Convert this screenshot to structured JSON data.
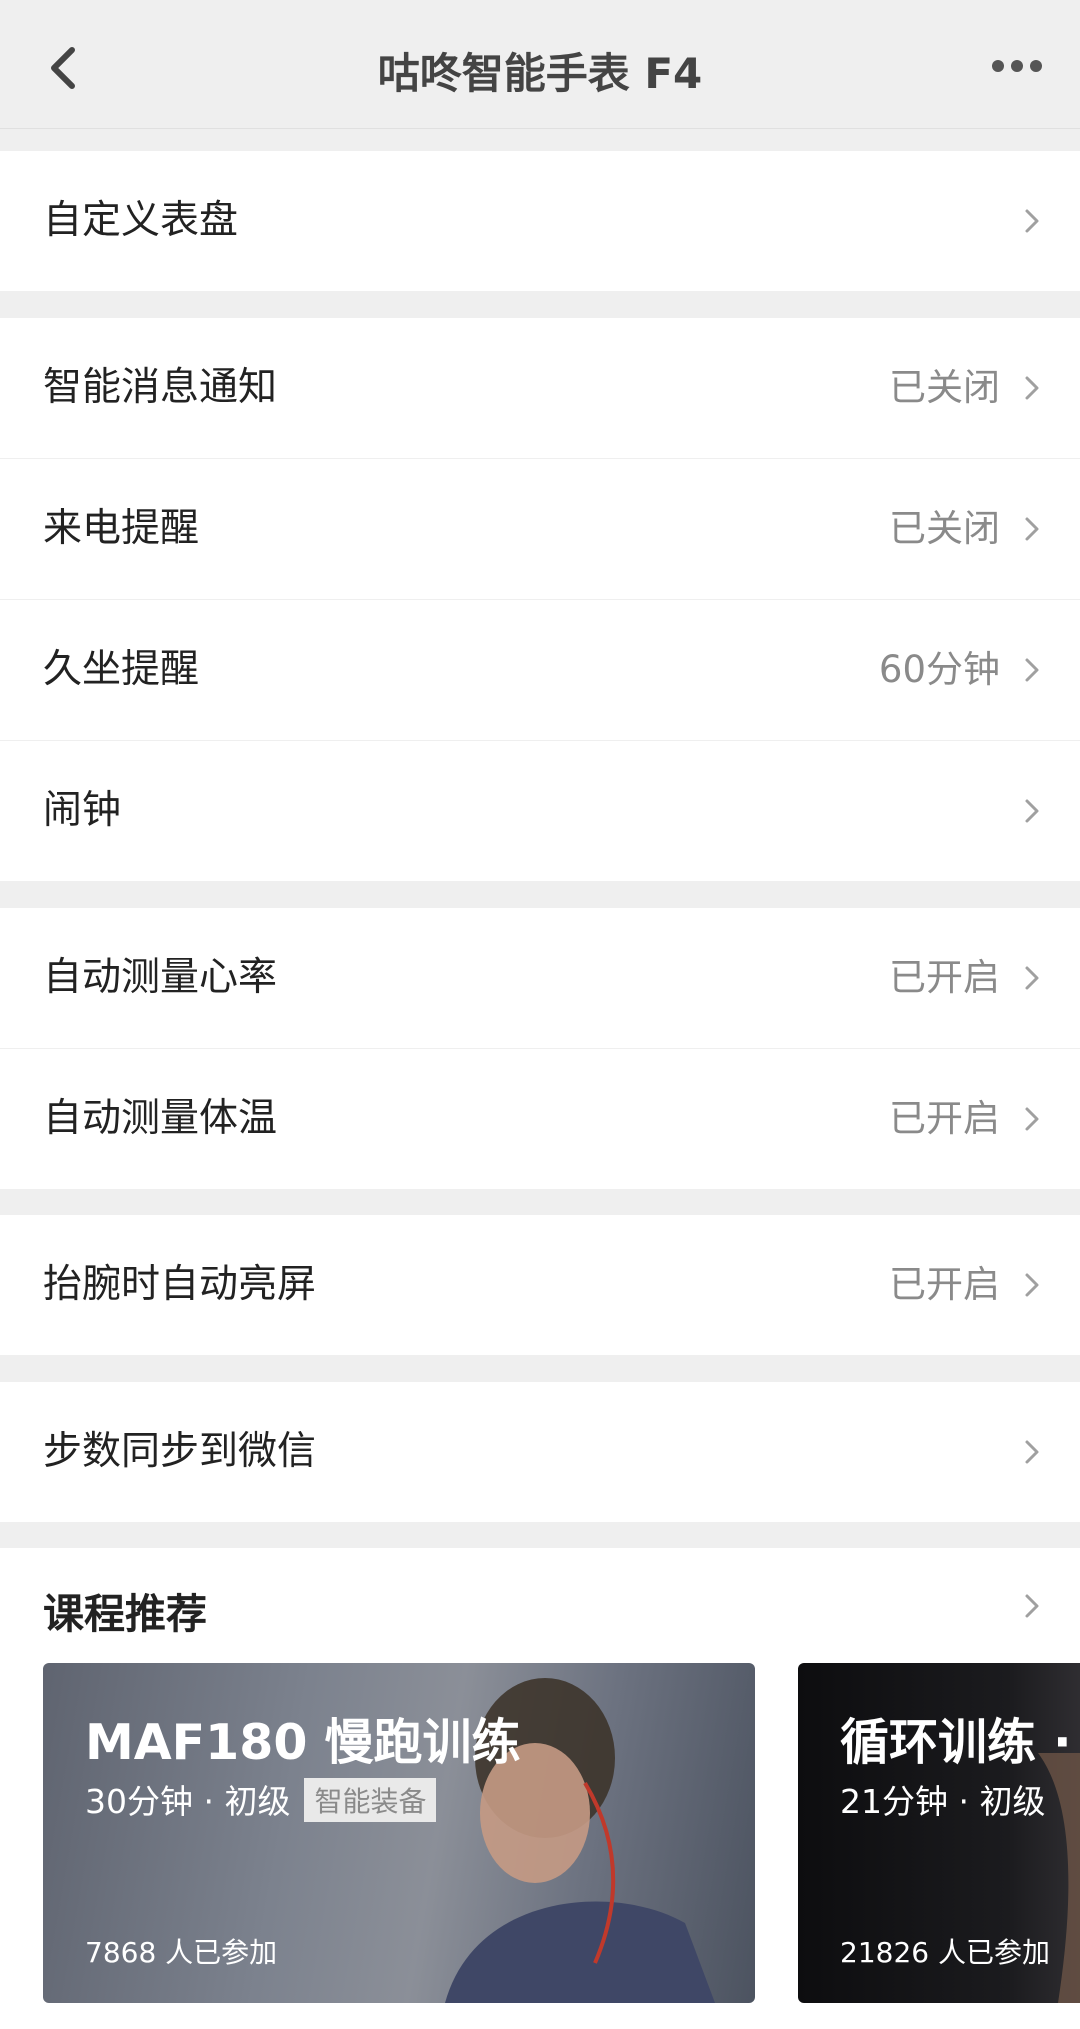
{
  "nav": {
    "title": "咕咚智能手表 F4",
    "back_icon": "chevron-left-icon",
    "more_icon": "more-dots-icon"
  },
  "groups": [
    {
      "items": [
        {
          "label": "自定义表盘",
          "value": ""
        }
      ]
    },
    {
      "items": [
        {
          "label": "智能消息通知",
          "value": "已关闭"
        },
        {
          "label": "来电提醒",
          "value": "已关闭"
        },
        {
          "label": "久坐提醒",
          "value": "60分钟"
        },
        {
          "label": "闹钟",
          "value": ""
        }
      ]
    },
    {
      "items": [
        {
          "label": "自动测量心率",
          "value": "已开启"
        },
        {
          "label": "自动测量体温",
          "value": "已开启"
        }
      ]
    },
    {
      "items": [
        {
          "label": "抬腕时自动亮屏",
          "value": "已开启"
        }
      ]
    },
    {
      "items": [
        {
          "label": "步数同步到微信",
          "value": ""
        }
      ]
    }
  ],
  "courses": {
    "heading": "课程推荐",
    "cards": [
      {
        "title": "MAF180 慢跑训练",
        "meta": "30分钟 · 初级",
        "tag": "智能装备",
        "count": "7868 人已参加"
      },
      {
        "title": "循环训练 ·",
        "meta": "21分钟 · 初级",
        "tag": "",
        "count": "21826 人已参加"
      }
    ]
  },
  "colors": {
    "background": "#efefef",
    "card": "#ffffff",
    "value_text": "#8a8a8a"
  }
}
